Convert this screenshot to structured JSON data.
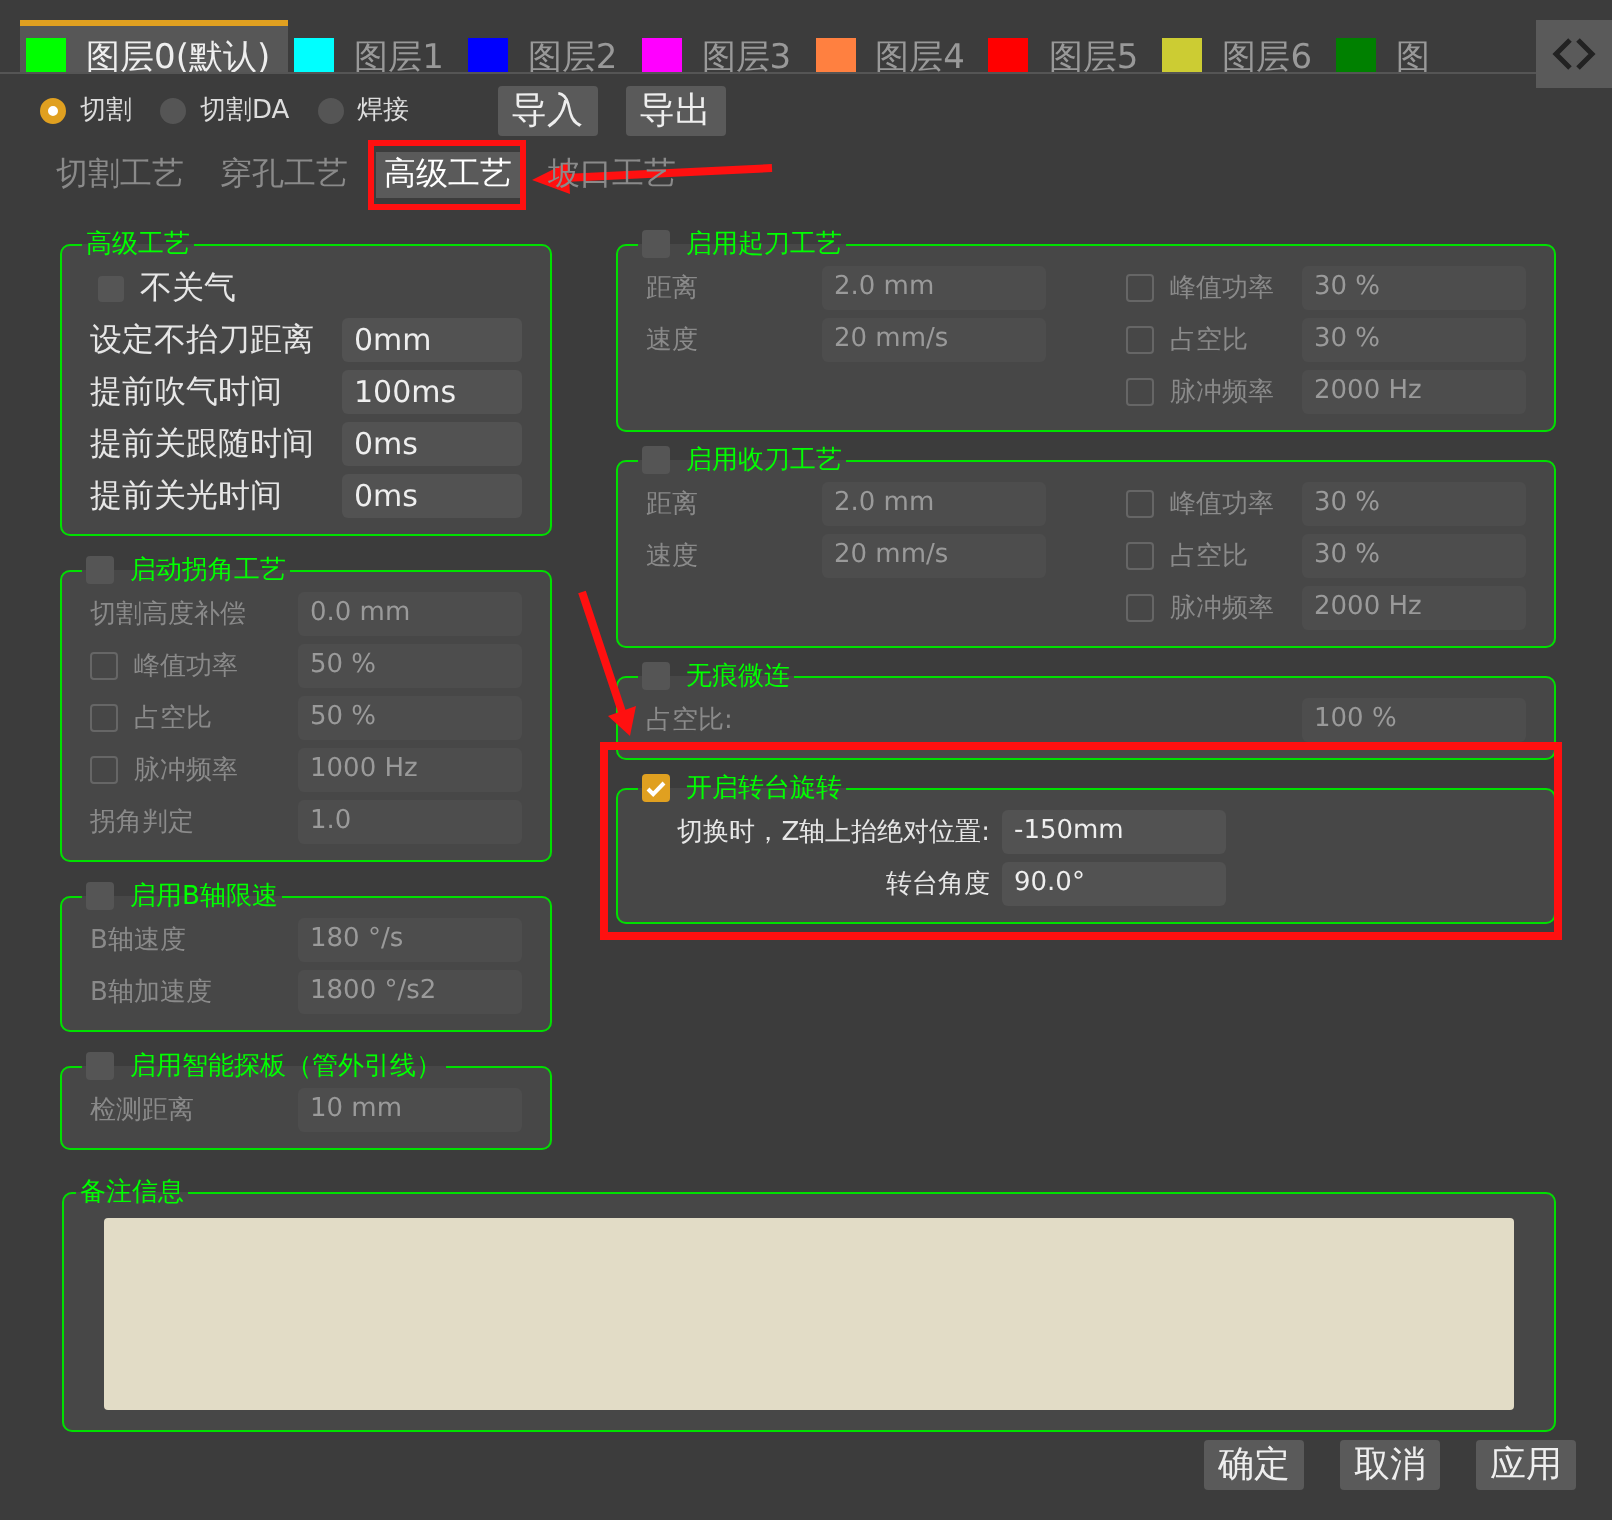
{
  "layers": [
    {
      "label": "图层0(默认)",
      "color": "#00ff00",
      "selected": true
    },
    {
      "label": "图层1",
      "color": "#00ffff",
      "selected": false
    },
    {
      "label": "图层2",
      "color": "#0000ff",
      "selected": false
    },
    {
      "label": "图层3",
      "color": "#ff00ff",
      "selected": false
    },
    {
      "label": "图层4",
      "color": "#ff8040",
      "selected": false
    },
    {
      "label": "图层5",
      "color": "#ff0000",
      "selected": false
    },
    {
      "label": "图层6",
      "color": "#cccc33",
      "selected": false
    },
    {
      "label": "图",
      "color": "#008000",
      "selected": false
    }
  ],
  "modes": [
    {
      "label": "切割",
      "selected": true
    },
    {
      "label": "切割DA",
      "selected": false
    },
    {
      "label": "焊接",
      "selected": false
    }
  ],
  "file_buttons": [
    "导入",
    "导出"
  ],
  "process_tabs": [
    {
      "label": "切割工艺",
      "selected": false,
      "highlighted": false
    },
    {
      "label": "穿孔工艺",
      "selected": false,
      "highlighted": false
    },
    {
      "label": "高级工艺",
      "selected": true,
      "highlighted": true
    },
    {
      "label": "坡口工艺",
      "selected": false,
      "highlighted": false
    }
  ],
  "left_groups": [
    {
      "title": "高级工艺",
      "enabled": true,
      "highlighted": false,
      "columns": [
        [
          {
            "kind": "check",
            "label": "不关气",
            "checked": false
          },
          {
            "kind": "field",
            "label": "设定不抬刀距离",
            "value": "0mm"
          },
          {
            "kind": "field",
            "label": "提前吹气时间",
            "value": "100ms"
          },
          {
            "kind": "field",
            "label": "提前关跟随时间",
            "value": "0ms"
          },
          {
            "kind": "field",
            "label": "提前关光时间",
            "value": "0ms"
          }
        ]
      ]
    },
    {
      "title": "启动拐角工艺",
      "toggle": {
        "checked": false
      },
      "enabled": false,
      "highlighted": false,
      "columns": [
        [
          {
            "kind": "field",
            "label": "切割高度补偿",
            "value": "0.0 mm"
          },
          {
            "kind": "check",
            "label": "峰值功率",
            "checked": false,
            "value": "50 %"
          },
          {
            "kind": "check",
            "label": "占空比",
            "checked": false,
            "value": "50 %"
          },
          {
            "kind": "check",
            "label": "脉冲频率",
            "checked": false,
            "value": "1000 Hz"
          },
          {
            "kind": "field",
            "label": "拐角判定",
            "value": "1.0"
          }
        ]
      ]
    },
    {
      "title": "启用B轴限速",
      "toggle": {
        "checked": false
      },
      "enabled": false,
      "highlighted": false,
      "columns": [
        [
          {
            "kind": "field",
            "label": "B轴速度",
            "value": "180 °/s"
          },
          {
            "kind": "field",
            "label": "B轴加速度",
            "value": "1800 °/s2"
          }
        ]
      ]
    },
    {
      "title": "启用智能探板（管外引线）",
      "toggle": {
        "checked": false
      },
      "enabled": false,
      "highlighted": false,
      "columns": [
        [
          {
            "kind": "field",
            "label": "检测距离",
            "value": "10 mm"
          }
        ]
      ]
    }
  ],
  "right_groups": [
    {
      "title": "启用起刀工艺",
      "toggle": {
        "checked": false
      },
      "enabled": false,
      "highlighted": false,
      "columns": [
        [
          {
            "kind": "field",
            "label": "距离",
            "value": "2.0 mm"
          },
          {
            "kind": "field",
            "label": "速度",
            "value": "20 mm/s"
          }
        ],
        [
          {
            "kind": "check",
            "label": "峰值功率",
            "checked": false,
            "value": "30 %"
          },
          {
            "kind": "check",
            "label": "占空比",
            "checked": false,
            "value": "30 %"
          },
          {
            "kind": "check",
            "label": "脉冲频率",
            "checked": false,
            "value": "2000 Hz"
          }
        ]
      ]
    },
    {
      "title": "启用收刀工艺",
      "toggle": {
        "checked": false
      },
      "enabled": false,
      "highlighted": false,
      "columns": [
        [
          {
            "kind": "field",
            "label": "距离",
            "value": "2.0 mm"
          },
          {
            "kind": "field",
            "label": "速度",
            "value": "20 mm/s"
          }
        ],
        [
          {
            "kind": "check",
            "label": "峰值功率",
            "checked": false,
            "value": "30 %"
          },
          {
            "kind": "check",
            "label": "占空比",
            "checked": false,
            "value": "30 %"
          },
          {
            "kind": "check",
            "label": "脉冲频率",
            "checked": false,
            "value": "2000 Hz"
          }
        ]
      ]
    },
    {
      "title": "无痕微连",
      "toggle": {
        "checked": false
      },
      "enabled": false,
      "highlighted": false,
      "columns": [
        [
          {
            "kind": "field",
            "label": "占空比:",
            "value": "100 %"
          }
        ]
      ]
    },
    {
      "title": "开启转台旋转",
      "toggle": {
        "checked": true
      },
      "enabled": true,
      "highlighted": true,
      "columns": [
        [
          {
            "kind": "field",
            "label": "切换时，Z轴上抬绝对位置:",
            "value": "-150mm"
          },
          {
            "kind": "field",
            "label": "转台角度",
            "value": "90.0°"
          }
        ]
      ]
    }
  ],
  "notes": {
    "title": "备注信息"
  },
  "dialog_buttons": [
    "确定",
    "取消",
    "应用"
  ]
}
